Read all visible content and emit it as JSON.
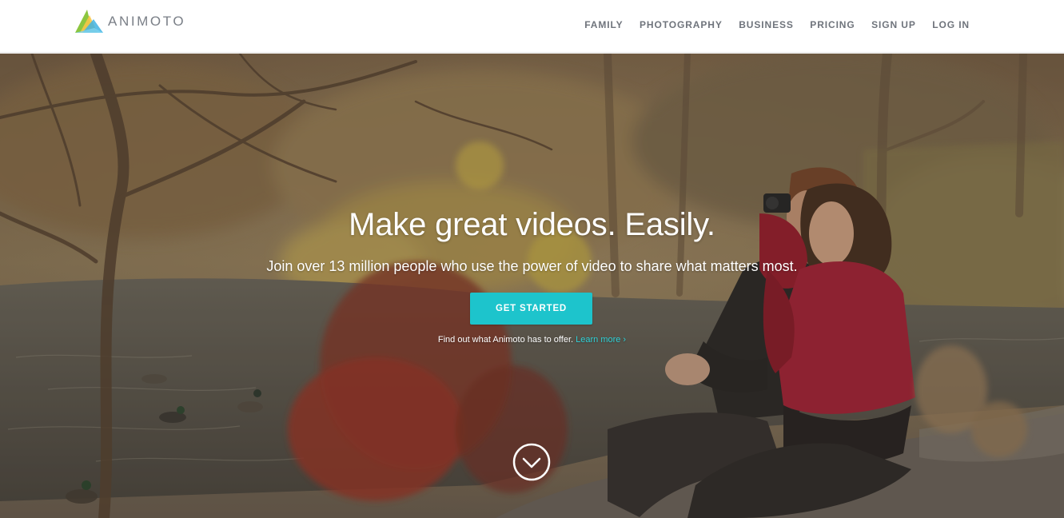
{
  "brand": {
    "name": "ANIMOTO",
    "logo_icon": "animoto-triangle-logo",
    "logo_colors": [
      "#8cc63f",
      "#f7c548",
      "#3fb3e3",
      "#7dd3f0"
    ]
  },
  "nav": {
    "items": [
      {
        "label": "FAMILY"
      },
      {
        "label": "PHOTOGRAPHY"
      },
      {
        "label": "BUSINESS"
      },
      {
        "label": "PRICING"
      },
      {
        "label": "SIGN UP"
      },
      {
        "label": "LOG IN"
      }
    ]
  },
  "hero": {
    "headline": "Make great videos. Easily.",
    "subhead": "Join over 13 million people who use the power of video to share what matters most.",
    "cta_label": "GET STARTED",
    "tagline": "Find out what Animoto has to offer.",
    "learn_more_label": "Learn more ›",
    "scroll_icon": "chevron-down-circle-icon",
    "background_image": "autumn-park-photo"
  },
  "colors": {
    "accent": "#1dc4cc",
    "link": "#2fd0d6",
    "nav_text": "#6f747c",
    "header_bg": "#ffffff"
  }
}
